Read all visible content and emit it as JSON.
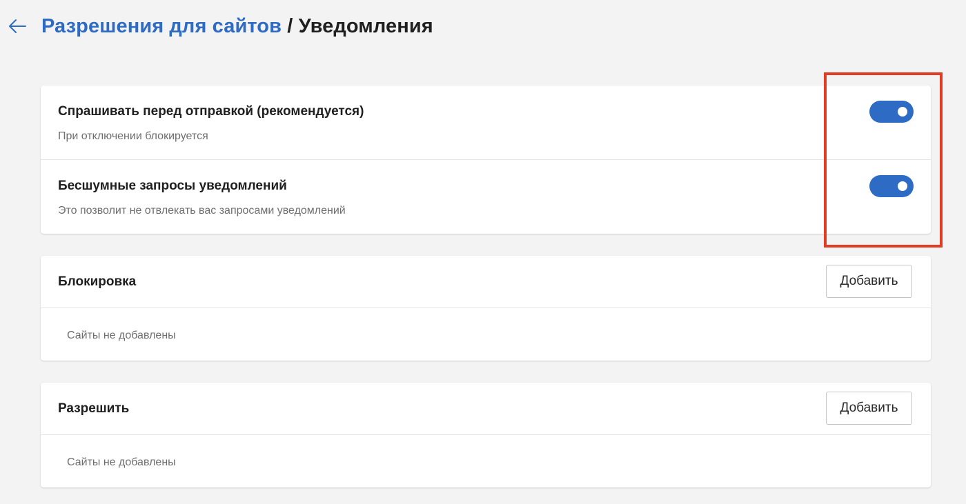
{
  "header": {
    "back_icon": "arrow-left-icon",
    "breadcrumb_parent": "Разрешения для сайтов",
    "breadcrumb_separator": "/",
    "breadcrumb_current": "Уведомления"
  },
  "settings": [
    {
      "title": "Спрашивать перед отправкой (рекомендуется)",
      "description": "При отключении блокируется",
      "enabled": true
    },
    {
      "title": "Бесшумные запросы уведомлений",
      "description": "Это позволит не отвлекать вас запросами уведомлений",
      "enabled": true
    }
  ],
  "block_section": {
    "title": "Блокировка",
    "add_label": "Добавить",
    "empty_text": "Сайты не добавлены"
  },
  "allow_section": {
    "title": "Разрешить",
    "add_label": "Добавить",
    "empty_text": "Сайты не добавлены"
  },
  "colors": {
    "accent": "#2d6bc4",
    "highlight": "#e03c24",
    "background": "#f3f3f3"
  }
}
